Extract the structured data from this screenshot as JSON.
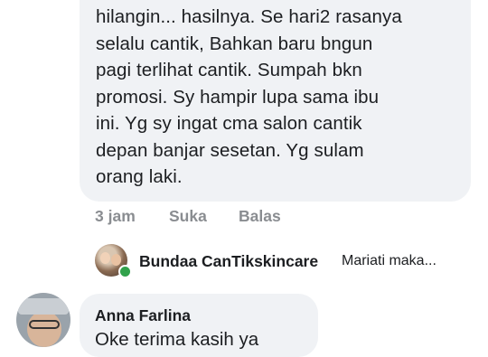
{
  "comment": {
    "lines": [
      "hilangin... hasilnya. Se hari2 rasanya",
      "selalu cantik,  Bahkan baru bngun",
      "pagi terlihat cantik. Sumpah bkn",
      "promosi.  Sy hampir lupa sama ibu",
      "ini.  Yg sy ingat cma salon cantik",
      "depan banjar sesetan.  Yg sulam",
      "orang laki."
    ],
    "time": "3 jam",
    "like_label": "Suka",
    "reply_label": "Balas"
  },
  "reply_preview": {
    "author": "Bundaa CanTikskincare",
    "snippet": "Mariati maka..."
  },
  "next_comment": {
    "author": "Anna Farlina",
    "text": "Oke terima kasih ya"
  },
  "colors": {
    "bubble": "#f0f2f5",
    "meta": "#8a8d91",
    "online": "#31a24c"
  }
}
